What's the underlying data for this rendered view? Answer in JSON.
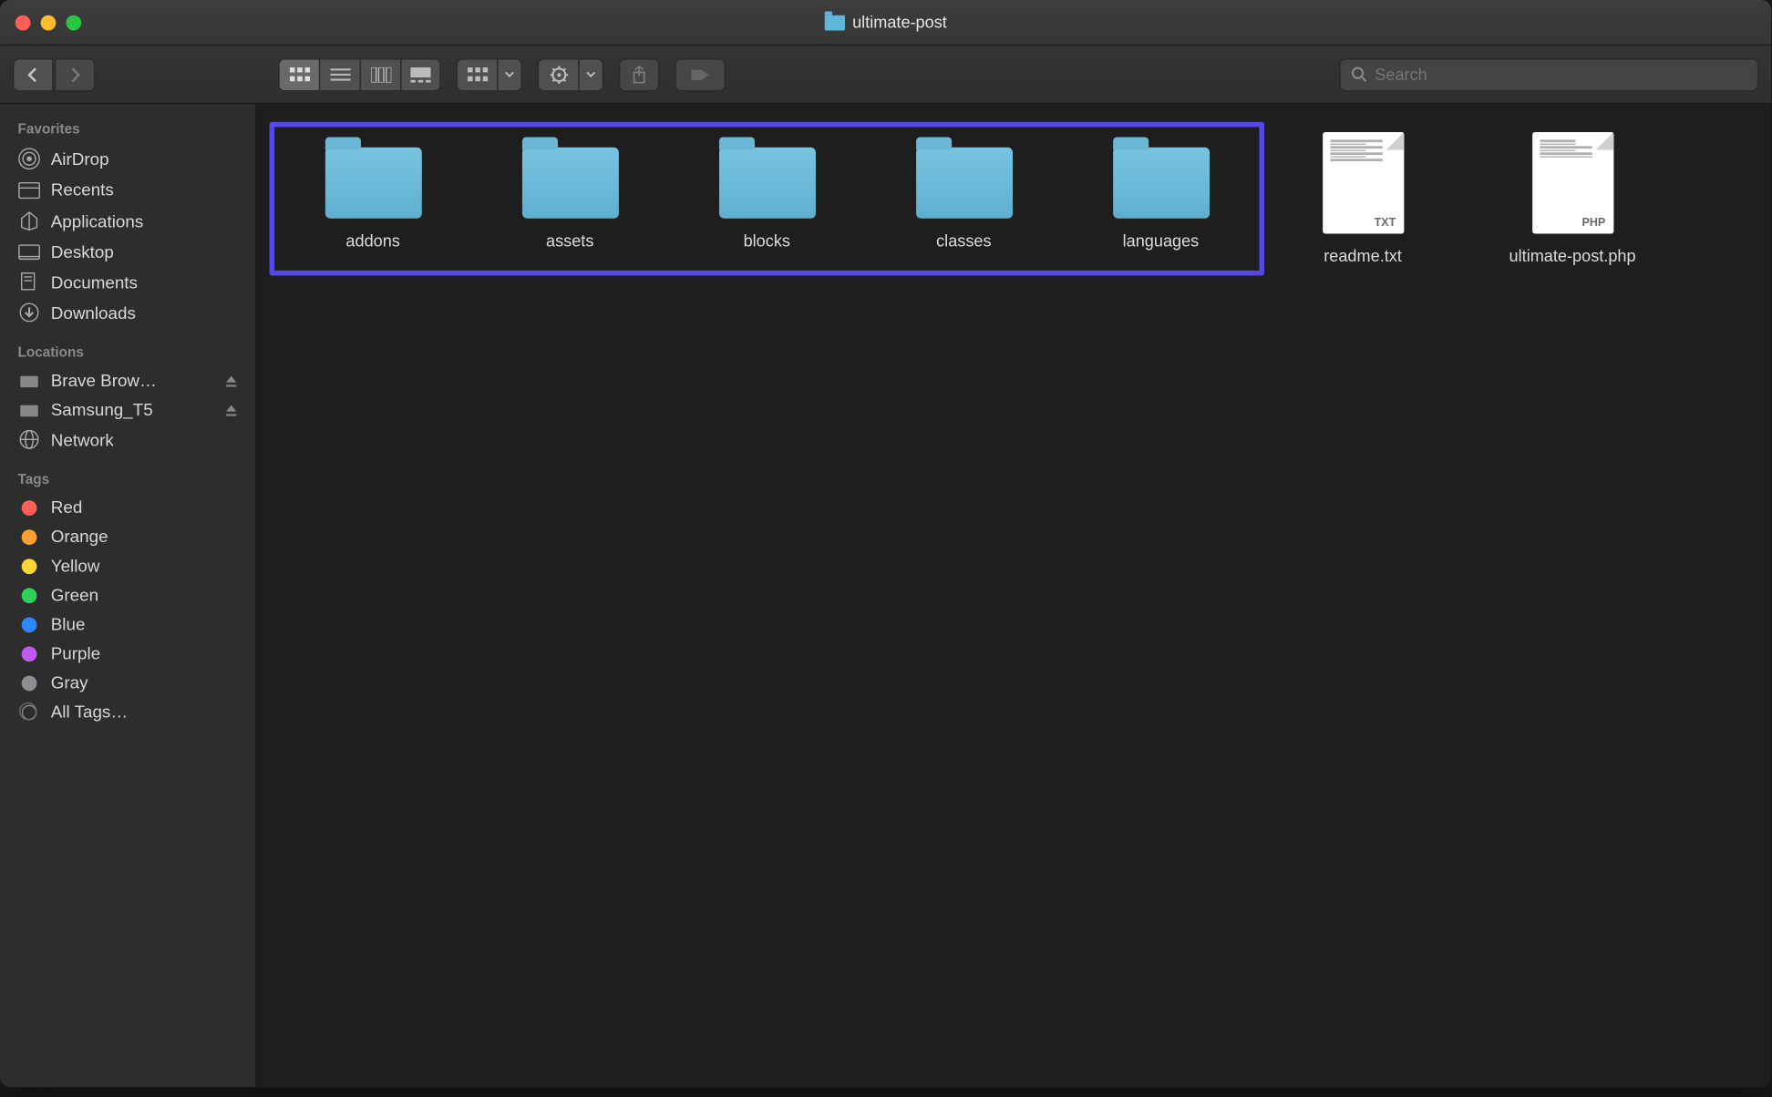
{
  "window": {
    "title": "ultimate-post"
  },
  "search": {
    "placeholder": "Search"
  },
  "sidebar": {
    "sections": [
      {
        "header": "Favorites",
        "items": [
          {
            "label": "AirDrop"
          },
          {
            "label": "Recents"
          },
          {
            "label": "Applications"
          },
          {
            "label": "Desktop"
          },
          {
            "label": "Documents"
          },
          {
            "label": "Downloads"
          }
        ]
      },
      {
        "header": "Locations",
        "items": [
          {
            "label": "Brave Brow…"
          },
          {
            "label": "Samsung_T5"
          },
          {
            "label": "Network"
          }
        ]
      },
      {
        "header": "Tags",
        "items": [
          {
            "label": "Red"
          },
          {
            "label": "Orange"
          },
          {
            "label": "Yellow"
          },
          {
            "label": "Green"
          },
          {
            "label": "Blue"
          },
          {
            "label": "Purple"
          },
          {
            "label": "Gray"
          },
          {
            "label": "All Tags…"
          }
        ]
      }
    ]
  },
  "items": {
    "selected": [
      {
        "name": "addons",
        "type": "folder"
      },
      {
        "name": "assets",
        "type": "folder"
      },
      {
        "name": "blocks",
        "type": "folder"
      },
      {
        "name": "classes",
        "type": "folder"
      },
      {
        "name": "languages",
        "type": "folder"
      }
    ],
    "unselected": [
      {
        "name": "readme.txt",
        "type": "file",
        "ext": "TXT"
      },
      {
        "name": "ultimate-post.php",
        "type": "file",
        "ext": "PHP"
      }
    ]
  }
}
